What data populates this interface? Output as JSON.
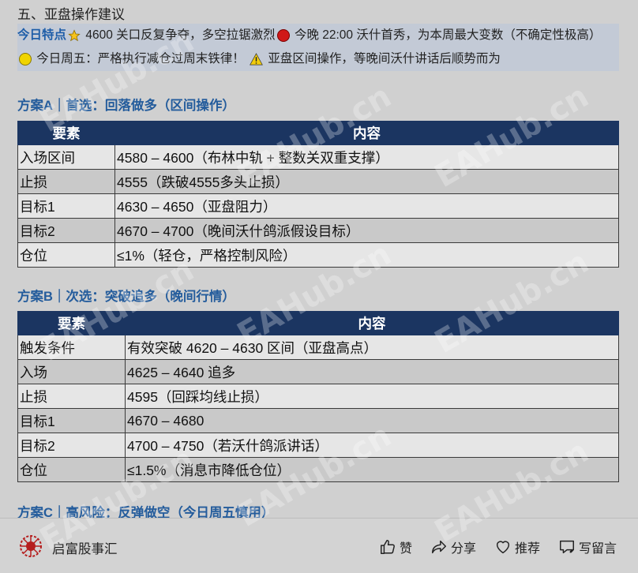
{
  "section": {
    "title": "五、亚盘操作建议"
  },
  "highlight": {
    "label": "今日特点",
    "part1": "4600 关口反复争夺，多空拉锯激烈",
    "part2": "今晚 22:00 沃什首秀，为本周最大变数（不确定性极高）",
    "part3": "今日周五：严格执行减仓过周末铁律！",
    "part4": "亚盘区间操作，等晚间沃什讲话后顺势而为"
  },
  "plan_a": {
    "title": "方案A｜首选：回落做多（区间操作）",
    "headers": [
      "要素",
      "内容"
    ],
    "rows": [
      [
        "入场区间",
        "4580 – 4600（布林中轨 + 整数关双重支撑）"
      ],
      [
        "止损",
        "4555（跌破4555多头止损）"
      ],
      [
        "目标1",
        "4630 – 4650（亚盘阻力）"
      ],
      [
        "目标2",
        "4670 – 4700（晚间沃什鸽派假设目标）"
      ],
      [
        "仓位",
        "≤1%（轻仓，严格控制风险）"
      ]
    ]
  },
  "plan_b": {
    "title": "方案B｜次选：突破追多（晚间行情）",
    "headers": [
      "要素",
      "内容"
    ],
    "rows": [
      [
        "触发条件",
        "有效突破 4620 – 4630 区间（亚盘高点）"
      ],
      [
        "入场",
        "4625 – 4640 追多"
      ],
      [
        "止损",
        "4595（回踩均线止损）"
      ],
      [
        "目标1",
        "4670 – 4680"
      ],
      [
        "目标2",
        "4700 – 4750（若沃什鸽派讲话）"
      ],
      [
        "仓位",
        "≤1.5%（消息市降低仓位）"
      ]
    ]
  },
  "plan_c": {
    "title": "方案C｜高风险：反弹做空（今日周五慎用）"
  },
  "watermark": "EAHub.cn",
  "footer": {
    "brand": "启富股事汇",
    "like": "赞",
    "share": "分享",
    "recommend": "推荐",
    "comment": "写留言"
  },
  "colors": {
    "header_bg": "#1b3561",
    "accent": "#245c9c",
    "highlight_bg": "#c3cad6"
  }
}
